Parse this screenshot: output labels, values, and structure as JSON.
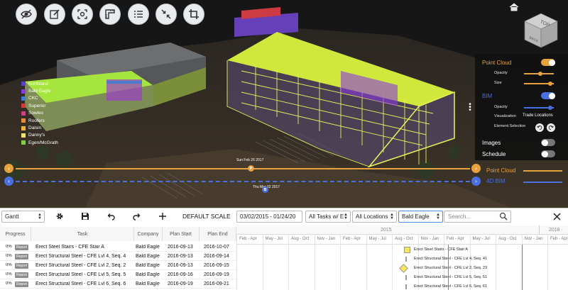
{
  "toolbar3d": {
    "buttons": [
      "visibility-icon",
      "edit-icon",
      "focus-icon",
      "measure-icon",
      "list-icon",
      "collapse-icon",
      "crop-icon"
    ]
  },
  "viewer": {
    "navcube": {
      "faces": [
        "TOP",
        "BACK"
      ]
    }
  },
  "legend": [
    {
      "label": "Northland",
      "color": "#5a3fd0"
    },
    {
      "label": "Bald Eagle",
      "color": "#8a3be0"
    },
    {
      "label": "CKC",
      "color": "#3c7fd8"
    },
    {
      "label": "Superior",
      "color": "#d8393c"
    },
    {
      "label": "Sowles",
      "color": "#d63b8a"
    },
    {
      "label": "Roofers",
      "color": "#e88a2e"
    },
    {
      "label": "Daisin",
      "color": "#f0b23a"
    },
    {
      "label": "Danny's",
      "color": "#f1e36a"
    },
    {
      "label": "Egen/McGrath",
      "color": "#7fd33c"
    }
  ],
  "settings": {
    "point_cloud": {
      "title": "Point Cloud",
      "opacity_label": "Opacity",
      "size_label": "Size",
      "enabled": true,
      "accent": "#e8a23c",
      "opacity": 0.55,
      "size": 0.85
    },
    "bim": {
      "title": "BIM",
      "opacity_label": "Opacity",
      "visualization_label": "Visualization",
      "visualization_value": "Trade Locations",
      "element_selection_label": "Element Selection",
      "enabled": true,
      "accent": "#4a6fe0",
      "opacity": 0.85
    },
    "images": {
      "title": "Images",
      "enabled": false
    },
    "schedule": {
      "title": "Schedule",
      "enabled": false
    }
  },
  "timeline": {
    "point_cloud_date": "Sun Feb 26 2017",
    "point_cloud_marker": "P",
    "bim_date": "Thu Mar 02 2017",
    "bim_marker": "B",
    "legend_point_cloud": "Point Cloud",
    "legend_bim": "4D BIM",
    "point_cloud_color": "#e8a23c",
    "bim_color": "#4a6fe0"
  },
  "gantt": {
    "view_select": "Gantt",
    "default_scale_label": "DEFAULT SCALE",
    "date_range": "03/02/2015 - 01/24/20",
    "task_filter": "All Tasks w/ E",
    "location_filter": "All Locations",
    "company_filter": "Bald Eagle",
    "search_placeholder": "Search...",
    "columns": [
      "Progress",
      "Task",
      "Company",
      "Plan Start",
      "Plan End"
    ],
    "rows": [
      {
        "progress": "0%",
        "badge": "Report",
        "task": "Erect Steel Stairs - CFE Stair A",
        "company": "Bald Eagle",
        "start": "2016-09-13",
        "end": "2016-10-07"
      },
      {
        "progress": "0%",
        "badge": "Report",
        "task": "Erect Structural Steel - CFE Lvl 4, Seq. 4",
        "company": "Bald Eagle",
        "start": "2016-09-13",
        "end": "2016-09-14"
      },
      {
        "progress": "0%",
        "badge": "Report",
        "task": "Erect Structural Steel - CFE Lvl 2, Seq. 2",
        "company": "Bald Eagle",
        "start": "2016-09-13",
        "end": "2016-09-15"
      },
      {
        "progress": "0%",
        "badge": "Report",
        "task": "Erect Structural Steel - CFE Lvl 5, Seq. 5",
        "company": "Bald Eagle",
        "start": "2016-09-16",
        "end": "2016-09-19"
      },
      {
        "progress": "0%",
        "badge": "Report",
        "task": "Erect Structural Steel - CFE Lvl 6, Seq. 6",
        "company": "Bald Eagle",
        "start": "2016-09-19",
        "end": "2016-09-21"
      }
    ],
    "years": [
      "2015",
      "2018"
    ],
    "months": [
      "Feb - Apr",
      "May - Jul",
      "Aug - Oct",
      "Nov - Jan",
      "Feb - Apr",
      "May - Jul",
      "Aug - Oct",
      "Nov - Jan",
      "Feb - Apr",
      "May - Jul",
      "Aug - Oct",
      "Nov - Jan",
      "Feb - Apr",
      "May - Jul"
    ],
    "task_labels": [
      "Erect Steel Stairs - CFE Stair A",
      "Erect Structural Steel - CFE Lvl 4, Seq. 41",
      "Erect Structural Steel - CFE Lvl 2, Seq. 23",
      "Erect Structural Steel - CFE Lvl 5, Seq. 51",
      "Erect Structural Steel - CFE Lvl 6, Seq. 61"
    ]
  }
}
